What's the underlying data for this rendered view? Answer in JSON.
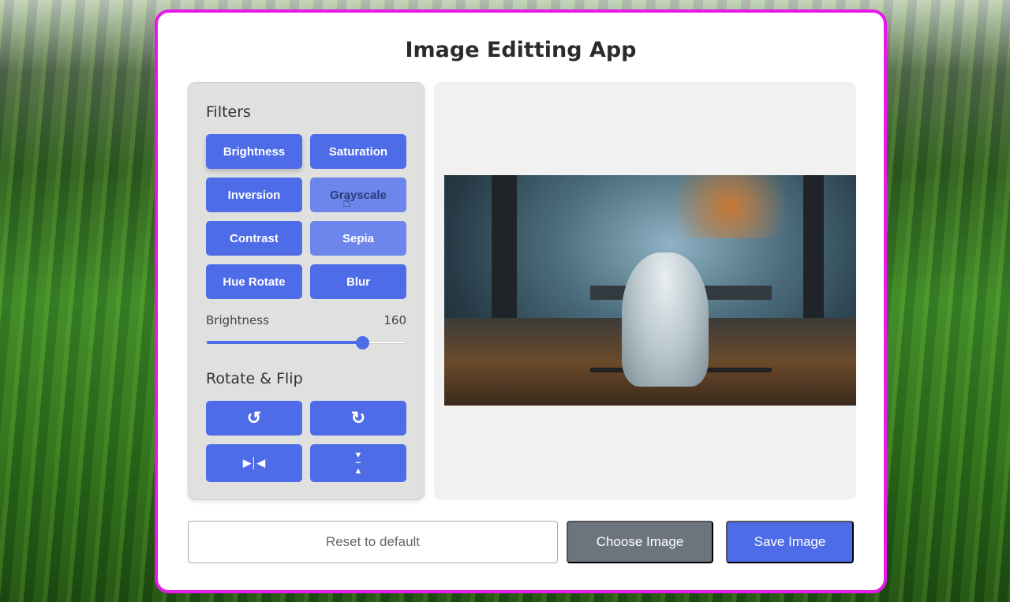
{
  "app": {
    "title": "Image Editting App"
  },
  "filters": {
    "heading": "Filters",
    "items": [
      {
        "label": "Brightness",
        "state": "active"
      },
      {
        "label": "Saturation"
      },
      {
        "label": "Inversion"
      },
      {
        "label": "Grayscale",
        "state": "hover"
      },
      {
        "label": "Contrast"
      },
      {
        "label": "Sepia",
        "state": "light"
      },
      {
        "label": "Hue Rotate"
      },
      {
        "label": "Blur"
      }
    ],
    "slider": {
      "label": "Brightness",
      "value": "160",
      "fraction": 0.78
    }
  },
  "rotate": {
    "heading": "Rotate & Flip",
    "icons": [
      "rotate-left-icon",
      "rotate-right-icon",
      "flip-horizontal-icon",
      "flip-vertical-icon"
    ]
  },
  "actions": {
    "reset": "Reset to default",
    "choose": "Choose Image",
    "save": "Save Image"
  },
  "colors": {
    "accent": "#4e6ce8",
    "frame": "#e619e6",
    "secondary": "#6c757d"
  }
}
